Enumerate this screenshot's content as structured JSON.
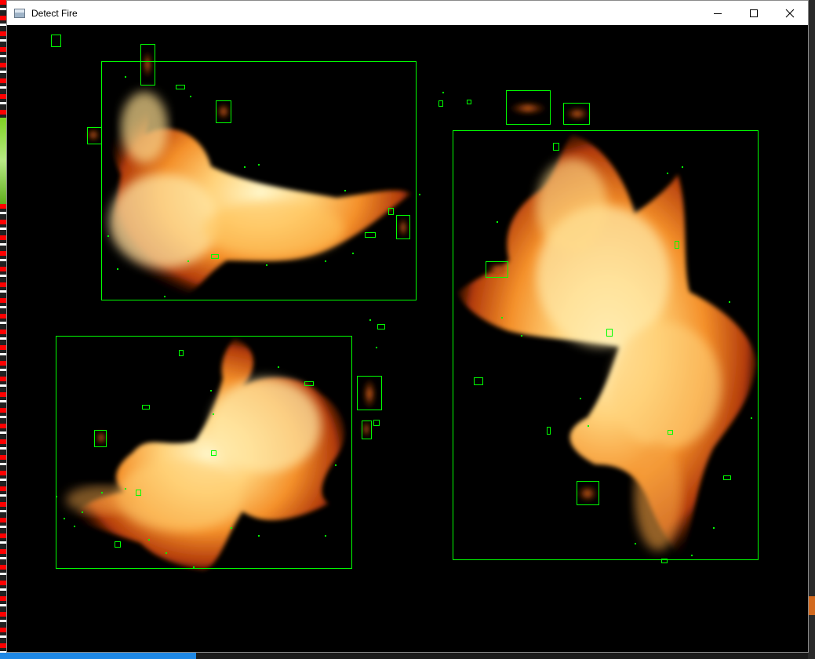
{
  "window": {
    "title": "Detect Fire",
    "icons": {
      "app": "app-window-icon",
      "minimize": "minimize-icon",
      "maximize": "maximize-icon",
      "close": "close-icon"
    }
  },
  "colors": {
    "box": "#00ff00",
    "background": "#000000",
    "fire_core": "#fff2b0",
    "fire_mid": "#ffb030",
    "fire_outer": "#c0400a"
  }
}
